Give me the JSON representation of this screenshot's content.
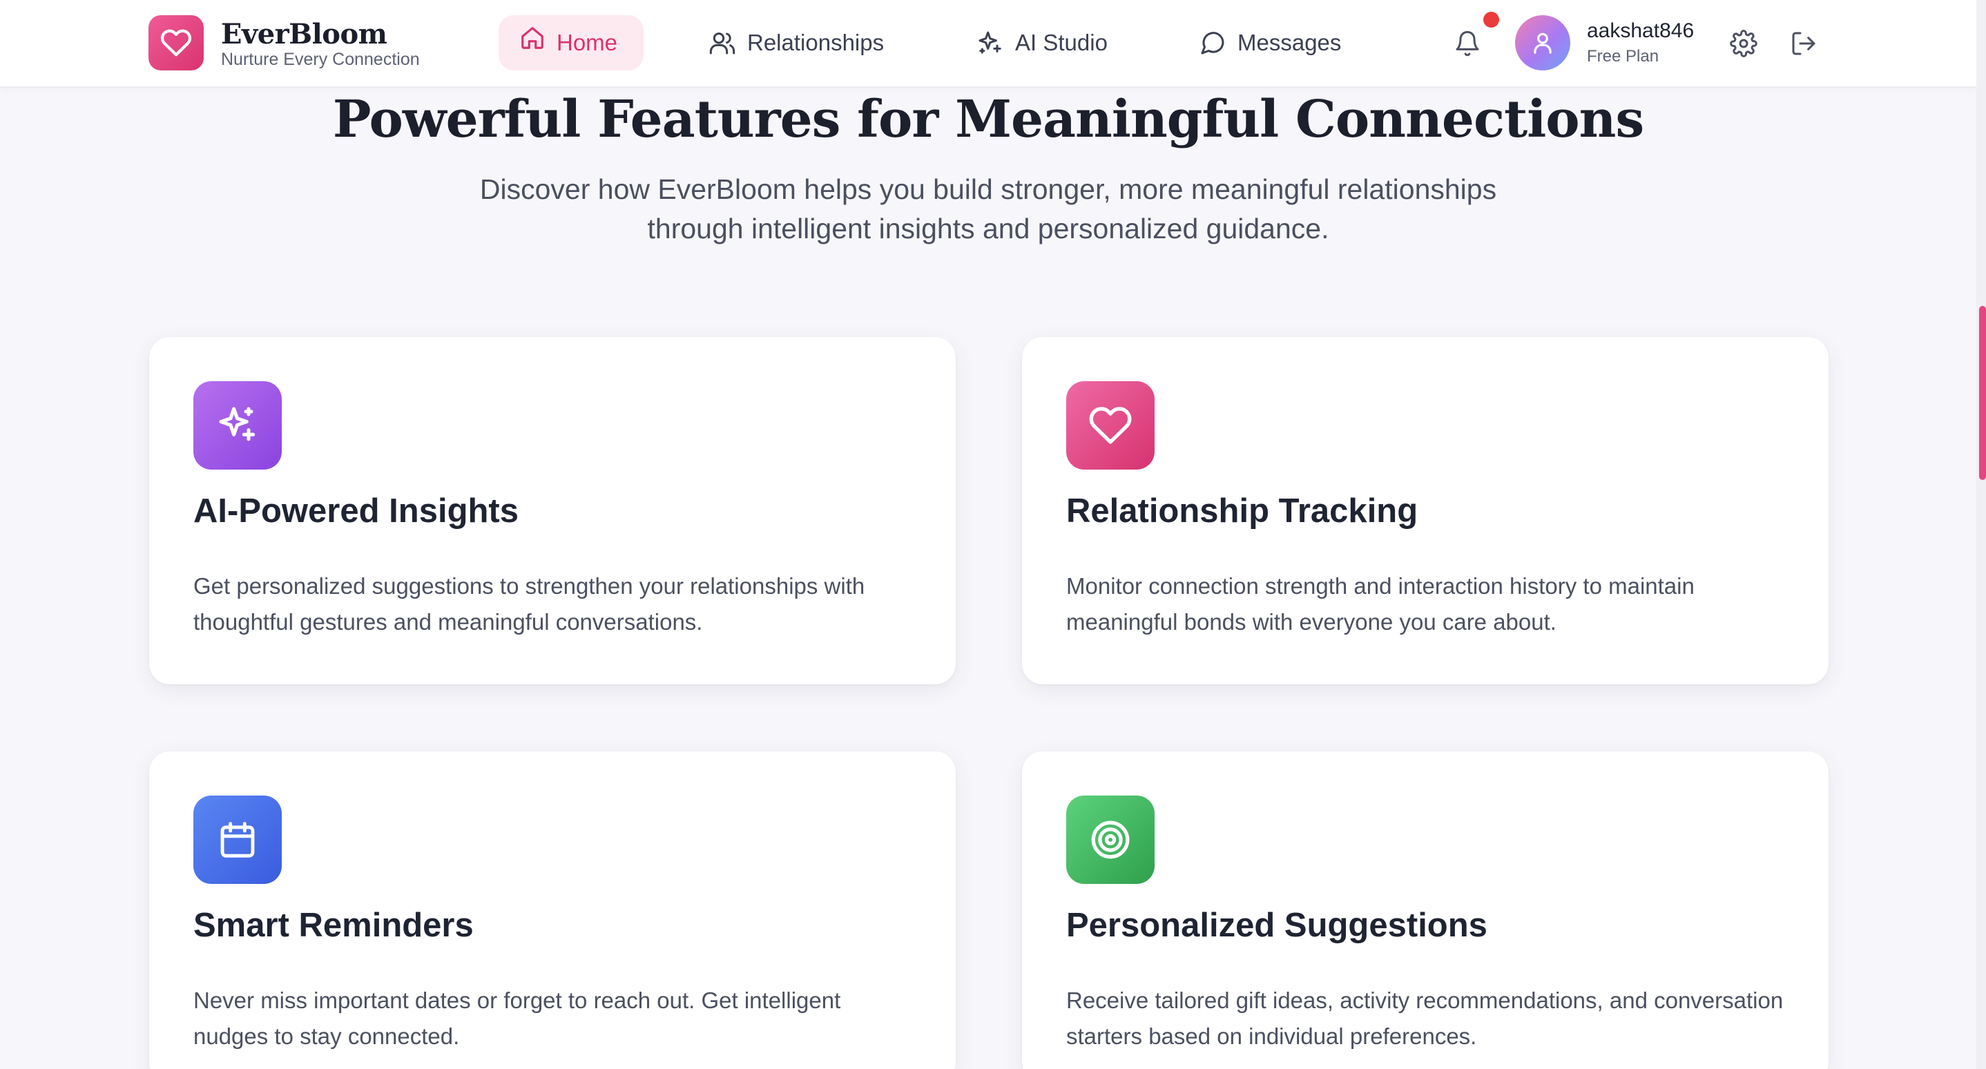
{
  "brand": {
    "name": "EverBloom",
    "tagline": "Nurture Every Connection"
  },
  "nav": {
    "items": [
      {
        "label": "Home",
        "icon": "home-icon",
        "active": true
      },
      {
        "label": "Relationships",
        "icon": "users-icon",
        "active": false
      },
      {
        "label": "AI Studio",
        "icon": "sparkles-icon",
        "active": false
      },
      {
        "label": "Messages",
        "icon": "message-circle-icon",
        "active": false
      }
    ]
  },
  "user": {
    "username": "aakshat846",
    "plan": "Free Plan",
    "has_notification": true
  },
  "features": {
    "title": "Powerful Features for Meaningful Connections",
    "subtitle_line1": "Discover how EverBloom helps you build stronger, more meaningful relationships",
    "subtitle_line2": "through intelligent insights and personalized guidance.",
    "cards": [
      {
        "title": "AI-Powered Insights",
        "description": "Get personalized suggestions to strengthen your relationships with thoughtful gestures and meaningful conversations.",
        "icon": "sparkles-icon",
        "color": "#9b55e6"
      },
      {
        "title": "Relationship Tracking",
        "description": "Monitor connection strength and interaction history to maintain meaningful bonds with everyone you care about.",
        "icon": "heart-icon",
        "color": "#e04b86"
      },
      {
        "title": "Smart Reminders",
        "description": "Never miss important dates or forget to reach out. Get intelligent nudges to stay connected.",
        "icon": "calendar-icon",
        "color": "#4670e8"
      },
      {
        "title": "Personalized Suggestions",
        "description": "Receive tailored gift ideas, activity recommendations, and conversation starters based on individual preferences.",
        "icon": "target-icon",
        "color": "#3cb35c"
      }
    ]
  },
  "colors": {
    "accent": "#d8336f",
    "accent_soft": "#fdeaf1",
    "page_background": "#f7f7fb",
    "notification_dot": "#ec3b3b"
  }
}
